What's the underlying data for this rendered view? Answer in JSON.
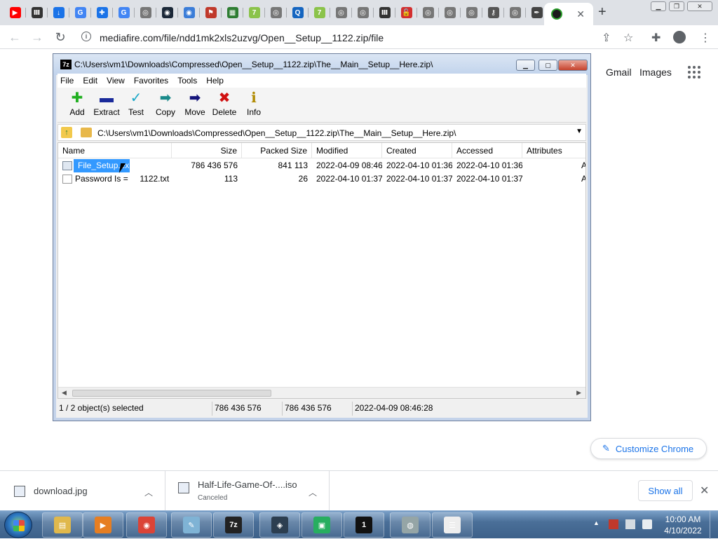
{
  "browser": {
    "tabs": [
      {
        "icon": "youtube-icon",
        "glyph": "▶",
        "color": "#ff0000"
      },
      {
        "icon": "library-icon",
        "glyph": "Ⅲ",
        "color": "#333333"
      },
      {
        "icon": "download-icon",
        "glyph": "↓",
        "color": "#1a73e8"
      },
      {
        "icon": "google-icon",
        "glyph": "G",
        "color": "#4285f4"
      },
      {
        "icon": "extension-icon",
        "glyph": "✚",
        "color": "#1a73e8"
      },
      {
        "icon": "google-icon",
        "glyph": "G",
        "color": "#4285f4"
      },
      {
        "icon": "globe-icon",
        "glyph": "◎",
        "color": "#777777"
      },
      {
        "icon": "steam-icon",
        "glyph": "◉",
        "color": "#1b2838"
      },
      {
        "icon": "steam-alt-icon",
        "glyph": "◉",
        "color": "#3b7dd8"
      },
      {
        "icon": "gamepad-icon",
        "glyph": "⚑",
        "color": "#c0392b"
      },
      {
        "icon": "grid-icon",
        "glyph": "▦",
        "color": "#2e7d32"
      },
      {
        "icon": "seven-icon",
        "glyph": "7",
        "color": "#8bc34a"
      },
      {
        "icon": "globe-icon",
        "glyph": "◎",
        "color": "#777777"
      },
      {
        "icon": "search-box-icon",
        "glyph": "Q",
        "color": "#1565c0"
      },
      {
        "icon": "seven-icon",
        "glyph": "7",
        "color": "#8bc34a"
      },
      {
        "icon": "globe-icon",
        "glyph": "◎",
        "color": "#777777"
      },
      {
        "icon": "globe-icon",
        "glyph": "◎",
        "color": "#777777"
      },
      {
        "icon": "library-icon",
        "glyph": "Ⅲ",
        "color": "#333333"
      },
      {
        "icon": "lock-icon",
        "glyph": "🔓",
        "color": "#d32f2f"
      },
      {
        "icon": "globe-icon",
        "glyph": "◎",
        "color": "#777777"
      },
      {
        "icon": "globe-icon",
        "glyph": "◎",
        "color": "#777777"
      },
      {
        "icon": "globe-icon",
        "glyph": "◎",
        "color": "#777777"
      },
      {
        "icon": "key-icon",
        "glyph": "⚷",
        "color": "#555555"
      },
      {
        "icon": "globe-icon",
        "glyph": "◎",
        "color": "#777777"
      },
      {
        "icon": "feather-icon",
        "glyph": "✒",
        "color": "#444444"
      }
    ],
    "url": "mediafire.com/file/ndd1mk2xls2uzvg/Open__Setup__1122.zip/file"
  },
  "google": {
    "gmail": "Gmail",
    "images": "Images",
    "customize": "Customize Chrome"
  },
  "zip": {
    "title": "C:\\Users\\vm1\\Downloads\\Compressed\\Open__Setup__1122.zip\\The__Main__Setup__Here.zip\\",
    "app_icon": "7z",
    "menu": [
      "File",
      "Edit",
      "View",
      "Favorites",
      "Tools",
      "Help"
    ],
    "tools": [
      {
        "label": "Add",
        "glyph": "✚",
        "color": "#22b022"
      },
      {
        "label": "Extract",
        "glyph": "▬",
        "color": "#1a2a9a"
      },
      {
        "label": "Test",
        "glyph": "✓",
        "color": "#1aa8c8"
      },
      {
        "label": "Copy",
        "glyph": "➡",
        "color": "#1a8a8a"
      },
      {
        "label": "Move",
        "glyph": "➡",
        "color": "#14147a"
      },
      {
        "label": "Delete",
        "glyph": "✖",
        "color": "#d01010"
      },
      {
        "label": "Info",
        "glyph": "ℹ",
        "color": "#b08a00"
      }
    ],
    "path": "C:\\Users\\vm1\\Downloads\\Compressed\\Open__Setup__1122.zip\\The__Main__Setup__Here.zip\\",
    "columns": [
      "Name",
      "Size",
      "Packed Size",
      "Modified",
      "Created",
      "Accessed",
      "Attributes"
    ],
    "rows": [
      {
        "name": "File_Setup.exe",
        "size": "786 436 576",
        "packed": "841 113",
        "modified": "2022-04-09 08:46",
        "created": "2022-04-10 01:36",
        "accessed": "2022-04-10 01:36",
        "attr": "A"
      },
      {
        "name": "Password Is =     1122.txt",
        "size": "113",
        "packed": "26",
        "modified": "2022-04-10 01:37",
        "created": "2022-04-10 01:37",
        "accessed": "2022-04-10 01:37",
        "attr": "A"
      }
    ],
    "status": {
      "selected": "1 / 2 object(s) selected",
      "size": "786 436 576",
      "packed": "786 436 576",
      "date": "2022-04-09 08:46:28"
    }
  },
  "downloads": {
    "items": [
      {
        "name": "download.jpg",
        "status": ""
      },
      {
        "name": "Half-Life-Game-Of-....iso",
        "status": "Canceled"
      }
    ],
    "show_all": "Show all"
  },
  "taskbar": {
    "clock_time": "10:00 AM",
    "clock_date": "4/10/2022",
    "apps": [
      {
        "icon": "explorer-icon",
        "glyph": "▤",
        "color": "#e0b84c"
      },
      {
        "icon": "media-player-icon",
        "glyph": "▶",
        "color": "#e67e22"
      },
      {
        "icon": "chrome-icon",
        "glyph": "◉",
        "color": "#db4437"
      },
      {
        "icon": "notepad-icon",
        "glyph": "✎",
        "color": "#7fb3d5"
      },
      {
        "icon": "sevenzip-icon",
        "glyph": "7z",
        "color": "#222222"
      },
      {
        "icon": "game-icon",
        "glyph": "◈",
        "color": "#2c3e50"
      },
      {
        "icon": "monitor-icon",
        "glyph": "▣",
        "color": "#27ae60"
      },
      {
        "icon": "media-icon",
        "glyph": "1",
        "color": "#111111"
      },
      {
        "icon": "disc-icon",
        "glyph": "◍",
        "color": "#95a5a6"
      },
      {
        "icon": "list-icon",
        "glyph": "☰",
        "color": "#eeeeee"
      }
    ]
  }
}
